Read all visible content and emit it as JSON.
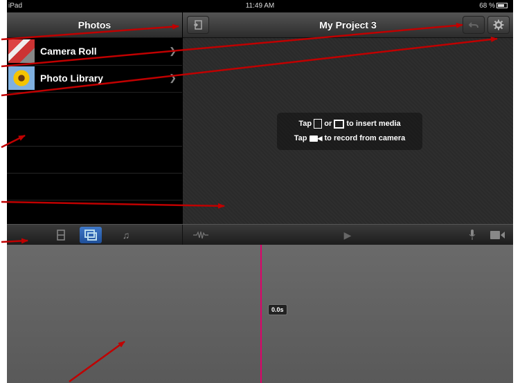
{
  "status": {
    "device": "iPad",
    "time": "11:49 AM",
    "battery": "68 %"
  },
  "photos_header": {
    "title": "Photos"
  },
  "project_header": {
    "title": "My Project 3"
  },
  "media_list": {
    "items": [
      {
        "label": "Camera Roll"
      },
      {
        "label": "Photo Library"
      }
    ]
  },
  "hint": {
    "line1_a": "Tap",
    "line1_b": "or",
    "line1_c": "to insert media",
    "line2_a": "Tap",
    "line2_b": "to record from camera"
  },
  "timeline": {
    "playhead_time": "0.0s",
    "playhead_color": "#e0006a"
  },
  "icons": {
    "import": "import-icon",
    "undo": "undo-icon",
    "settings": "gear-icon",
    "video_tab": "film-icon",
    "photos_tab": "photos-icon",
    "audio_tab": "music-icon",
    "waveform": "waveform-icon",
    "play": "play-icon",
    "mic": "microphone-icon",
    "camera": "video-camera-icon"
  },
  "colors": {
    "accent": "#3e78c8",
    "annotation_arrow": "#c00000"
  }
}
